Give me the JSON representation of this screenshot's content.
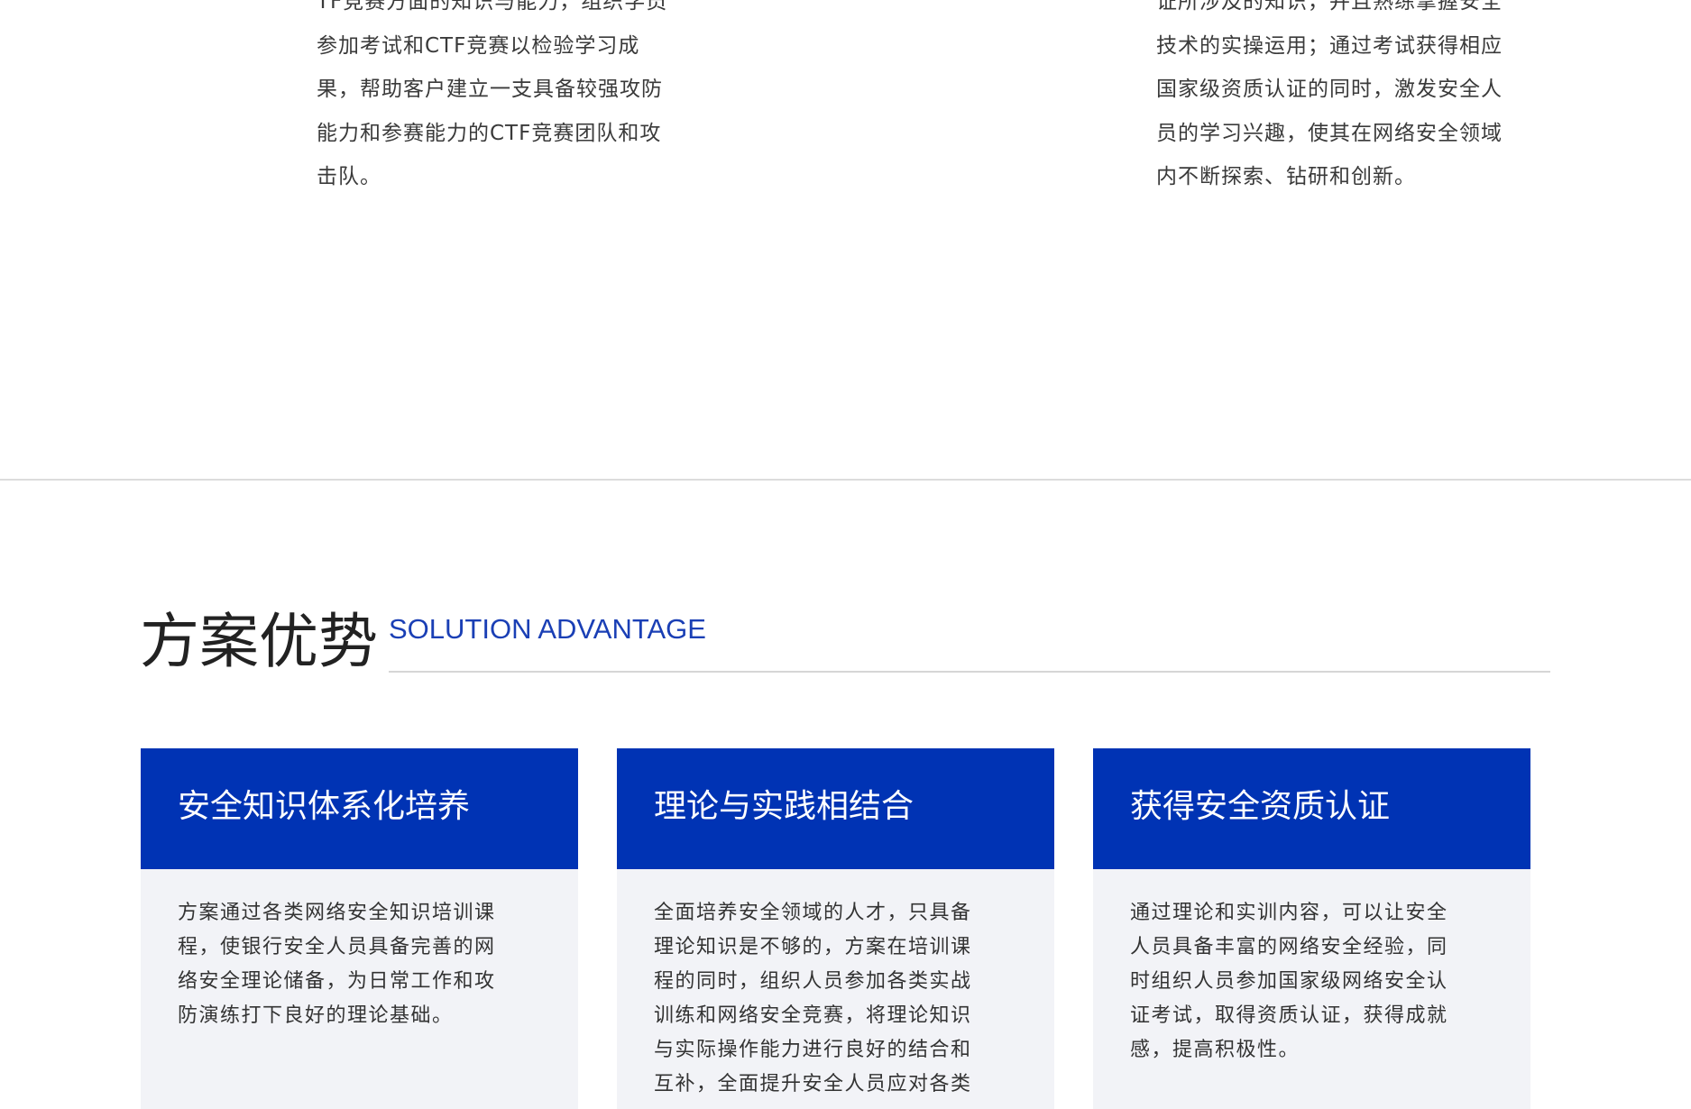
{
  "top_section": {
    "left_text": "TF竞赛方面的知识与能力，组织学员\n参加考试和CTF竞赛以检验学习成\n果，帮助客户建立一支具备较强攻防\n能力和参赛能力的CTF竞赛团队和攻\n击队。",
    "right_text": "证所涉及的知识，并且熟练掌握安全\n技术的实操运用；通过考试获得相应\n国家级资质认证的同时，激发安全人\n员的学习兴趣，使其在网络安全领域\n内不断探索、钻研和创新。"
  },
  "advantage_section": {
    "title": "方案优势",
    "subtitle": "SOLUTION ADVANTAGE",
    "cards": [
      {
        "title": "安全知识体系化培养",
        "text": "方案通过各类网络安全知识培训课\n程，使银行安全人员具备完善的网\n络安全理论储备，为日常工作和攻\n防演练打下良好的理论基础。"
      },
      {
        "title": "理论与实践相结合",
        "text": "全面培养安全领域的人才，只具备\n理论知识是不够的，方案在培训课\n程的同时，组织人员参加各类实战\n训练和网络安全竞赛，将理论知识\n与实际操作能力进行良好的结合和\n互补，全面提升安全人员应对各类"
      },
      {
        "title": "获得安全资质认证",
        "text": "通过理论和实训内容，可以让安全\n人员具备丰富的网络安全经验，同\n时组织人员参加国家级网络安全认\n证考试，取得资质认证，获得成就\n感，提高积极性。"
      }
    ]
  },
  "colors": {
    "brand_blue": "#0033b4",
    "subtitle_blue": "#1a3fb5",
    "card_background": "#f2f3f7"
  }
}
